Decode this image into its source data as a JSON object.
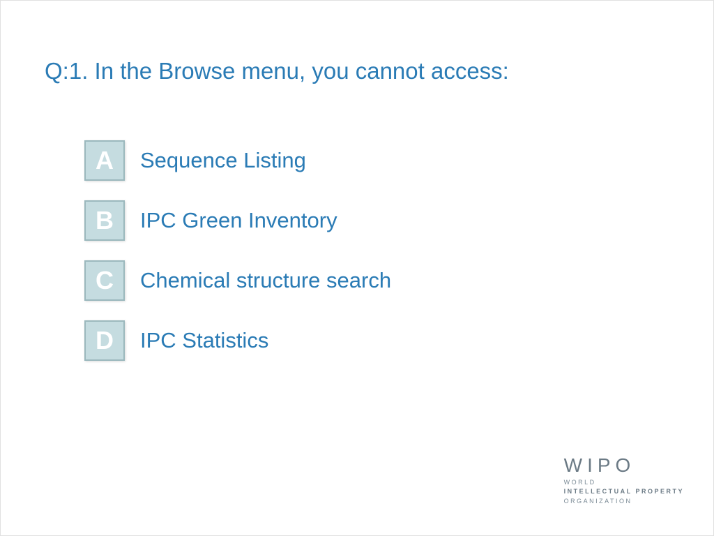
{
  "question": {
    "title": "Q:1. In the Browse menu, you cannot access:"
  },
  "options": [
    {
      "letter": "A",
      "text": "Sequence Listing"
    },
    {
      "letter": "B",
      "text": "IPC Green Inventory"
    },
    {
      "letter": "C",
      "text": "Chemical structure search"
    },
    {
      "letter": "D",
      "text": "IPC Statistics"
    }
  ],
  "logo": {
    "main": "WIPO",
    "line1": "WORLD",
    "line2": "INTELLECTUAL PROPERTY",
    "line3": "ORGANIZATION"
  }
}
